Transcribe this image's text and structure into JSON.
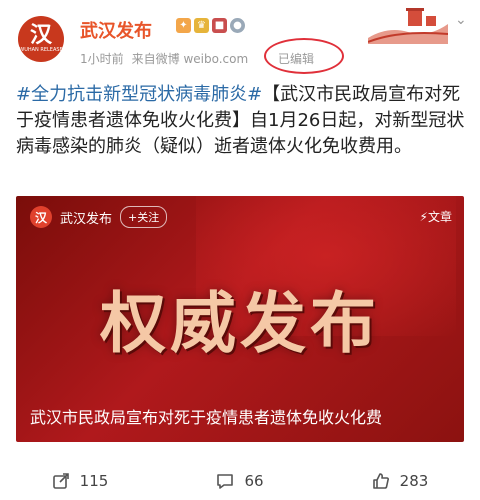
{
  "post": {
    "author": "武汉发布",
    "avatar_text": "汉",
    "avatar_sub": "WUHAN RELEASE",
    "time": "1小时前",
    "source": "来自微博 weibo.com",
    "edited": "已编辑",
    "hashtag": "#全力抗击新型冠状病毒肺炎#",
    "text": "【武汉市民政局宣布对死于疫情患者遗体免收火化费】自1月26日起，对新型冠状病毒感染的肺炎（疑似）逝者遗体火化免收费用。"
  },
  "card": {
    "author": "武汉发布",
    "avatar_text": "汉",
    "follow_label": "+关注",
    "article_label": "文章",
    "big_title": "权威发布",
    "caption": "武汉市民政局宣布对死于疫情患者遗体免收火化费"
  },
  "actions": {
    "repost": "115",
    "comment": "66",
    "like": "283"
  },
  "colors": {
    "accent": "#e8552a",
    "link": "#2b6aa6",
    "card_red": "#b0191c"
  }
}
